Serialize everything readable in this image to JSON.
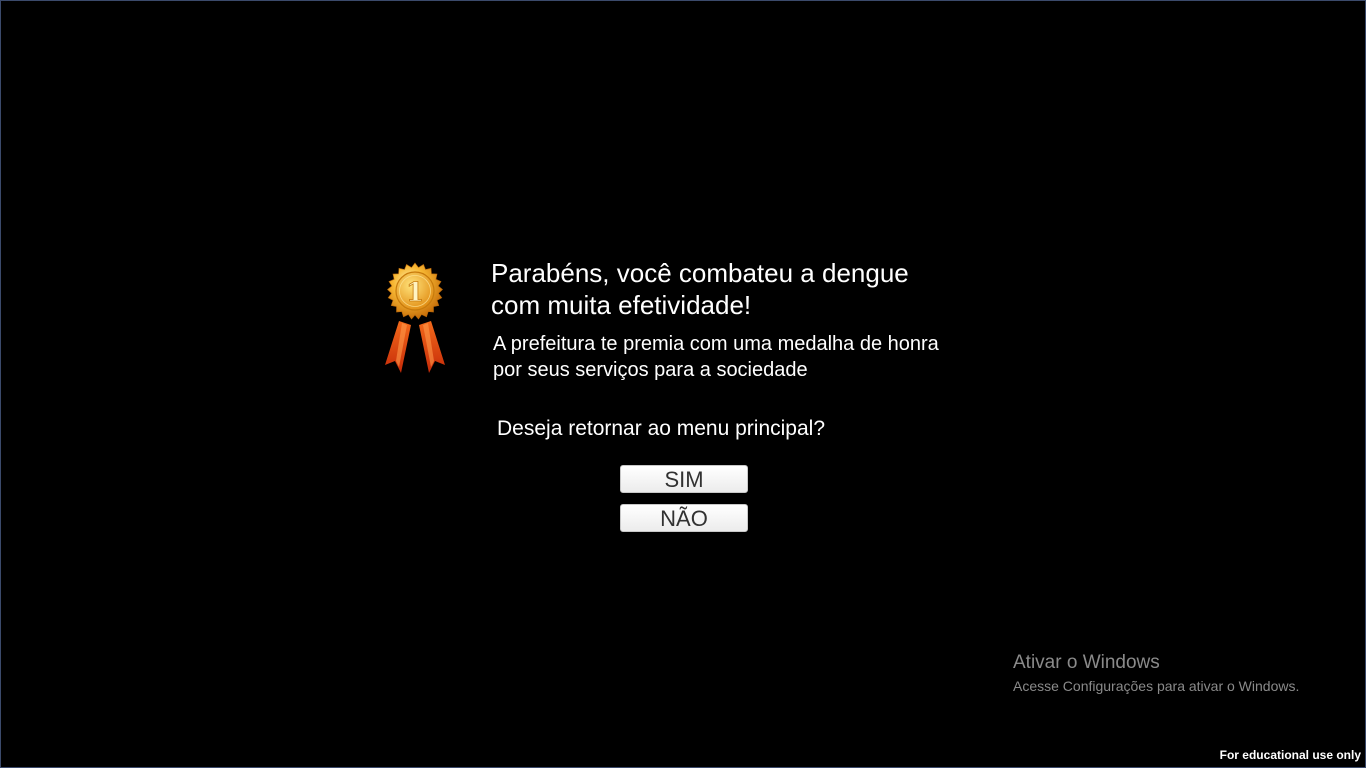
{
  "dialog": {
    "title_line1": "Parabéns, você combateu a dengue",
    "title_line2": "com muita efetividade!",
    "subtitle_line1": "A prefeitura te premia com uma medalha de honra",
    "subtitle_line2": "por seus serviços para a sociedade",
    "question": "Deseja retornar ao menu principal?",
    "yes_label": "SIM",
    "no_label": "NÃO",
    "medal_number": "1"
  },
  "watermark": {
    "title": "Ativar o Windows",
    "subtitle": "Acesse Configurações para ativar o Windows."
  },
  "footer": {
    "notice": "For educational use only"
  },
  "colors": {
    "background": "#000000",
    "text": "#ffffff",
    "medal_gold": "#f5a623",
    "ribbon": "#e8501c",
    "watermark": "#8a8a8a"
  },
  "icons": {
    "medal": "gold-medal-icon"
  }
}
